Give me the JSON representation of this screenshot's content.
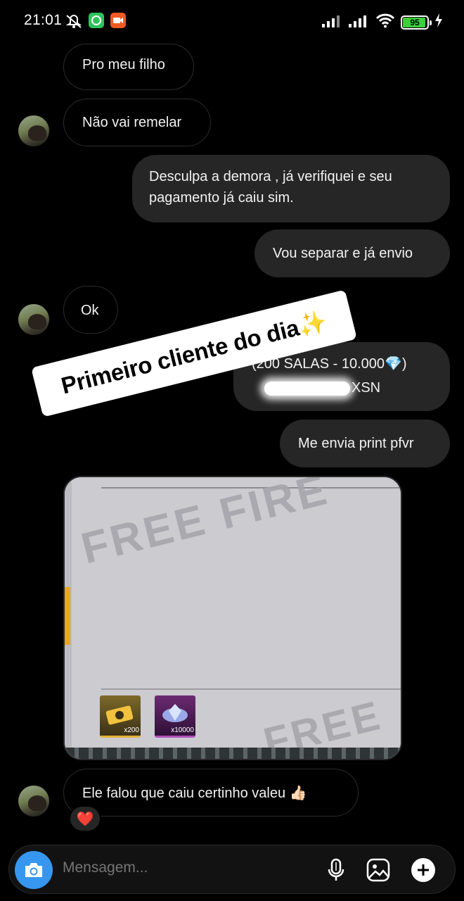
{
  "status_bar": {
    "time": "21:01",
    "battery_level": "95",
    "battery_fraction": 0.95,
    "icons": [
      "mute-icon",
      "whatsapp-icon",
      "video-recorder-icon",
      "signal-icon",
      "signal-icon",
      "wifi-icon",
      "battery-icon",
      "charging-icon"
    ]
  },
  "messages": [
    {
      "direction": "incoming",
      "text": "Pro meu filho",
      "partially_visible": true
    },
    {
      "direction": "incoming",
      "text": "Não vai remelar"
    },
    {
      "direction": "outgoing",
      "lines": [
        "Desculpa a demora , já verifiquei e seu",
        "pagamento já caiu sim."
      ]
    },
    {
      "direction": "outgoing",
      "text": "Vou separar e já envio"
    },
    {
      "direction": "incoming",
      "text": "Ok"
    },
    {
      "direction": "outgoing",
      "line1": "(200 SALAS - 10.000💎)",
      "line2_suffix": "XSN"
    },
    {
      "direction": "outgoing",
      "text": "Me envia print pfvr"
    },
    {
      "direction": "incoming",
      "type": "image",
      "watermark_top": "FREE FIRE",
      "watermark_bottom": "FREE",
      "items": [
        {
          "qty": "x200",
          "icon": "room-card-icon"
        },
        {
          "qty": "x10000",
          "icon": "diamond-icon"
        }
      ]
    },
    {
      "direction": "incoming",
      "text": "Ele falou que caiu certinho valeu 👍🏻",
      "reaction": "❤️"
    }
  ],
  "sticker": {
    "text": "Primeiro cliente do dia✨"
  },
  "composer": {
    "placeholder": "Mensagem...",
    "icons": [
      "camera-icon",
      "microphone-icon",
      "gallery-icon",
      "add-icon"
    ]
  },
  "colors": {
    "accent": "#3797f0",
    "outgoing_bubble": "#262626",
    "background": "#000000",
    "reaction": "#e0243a"
  }
}
